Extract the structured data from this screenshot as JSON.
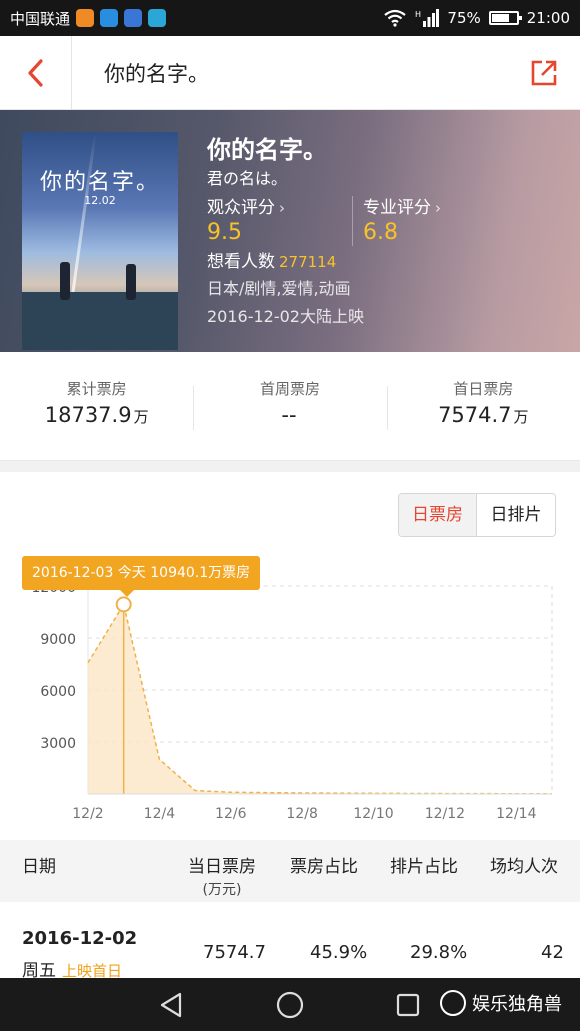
{
  "status_bar": {
    "carrier": "中国联通",
    "battery_pct": "75%",
    "battery_level": 0.75,
    "time": "21:00",
    "icons": [
      "app-orange-icon",
      "app-blue-b-icon",
      "app-health-icon",
      "app-edit-icon",
      "wifi-icon",
      "signal-icon",
      "battery-icon"
    ]
  },
  "nav": {
    "title": "你的名字。",
    "back_icon": "chevron-left-icon",
    "share_icon": "share-icon",
    "accent": "#e6452f"
  },
  "movie": {
    "poster": {
      "title": "你的名字。",
      "date": "12.02"
    },
    "title": "你的名字。",
    "original_title": "君の名は。",
    "audience_rating_label": "观众评分",
    "audience_rating": "9.5",
    "pro_rating_label": "专业评分",
    "pro_rating": "6.8",
    "want_label": "想看人数",
    "want_count": "277114",
    "genre": "日本/剧情,爱情,动画",
    "release": "2016-12-02大陆上映",
    "rating_color": "#f8c22a"
  },
  "summary": [
    {
      "label": "累计票房",
      "value": "18737.9",
      "unit": "万"
    },
    {
      "label": "首周票房",
      "value": "--",
      "unit": ""
    },
    {
      "label": "首日票房",
      "value": "7574.7",
      "unit": "万"
    }
  ],
  "toggle": {
    "active": "日票房",
    "inactive": "日排片"
  },
  "tooltip": "2016-12-03 今天 10940.1万票房",
  "chart_data": {
    "type": "area",
    "x": [
      "12/2",
      "12/3",
      "12/4",
      "12/5",
      "12/6",
      "12/7",
      "12/8",
      "12/9",
      "12/10",
      "12/11",
      "12/12",
      "12/13",
      "12/14",
      "12/15"
    ],
    "x_tick_labels": [
      "12/2",
      "12/4",
      "12/6",
      "12/8",
      "12/10",
      "12/12",
      "12/14"
    ],
    "series": [
      {
        "values": [
          7574.7,
          10940.1,
          2000,
          200,
          100,
          80,
          60,
          50,
          40,
          30,
          25,
          20,
          15,
          10
        ]
      }
    ],
    "y_ticks": [
      "3000",
      "6000",
      "9000",
      "12000"
    ],
    "ylim": [
      0,
      12000
    ],
    "grid": true,
    "highlight_index": 1,
    "fill_color": "#fbe6c4",
    "line_color": "#f1b14a"
  },
  "table": {
    "headers": [
      {
        "label": "日期",
        "sub": ""
      },
      {
        "label": "当日票房",
        "sub": "(万元)"
      },
      {
        "label": "票房占比",
        "sub": ""
      },
      {
        "label": "排片占比",
        "sub": ""
      },
      {
        "label": "场均人次",
        "sub": ""
      }
    ],
    "rows": [
      {
        "date": "2016-12-02",
        "weekday": "周五",
        "tag": "上映首日",
        "box_office": "7574.7",
        "box_share": "45.9%",
        "screen_share": "29.8%",
        "avg_people": "42"
      }
    ]
  },
  "android_nav": {
    "icons": [
      "back-triangle-icon",
      "home-circle-icon",
      "recents-square-icon"
    ],
    "watermark": "娱乐独角兽"
  }
}
